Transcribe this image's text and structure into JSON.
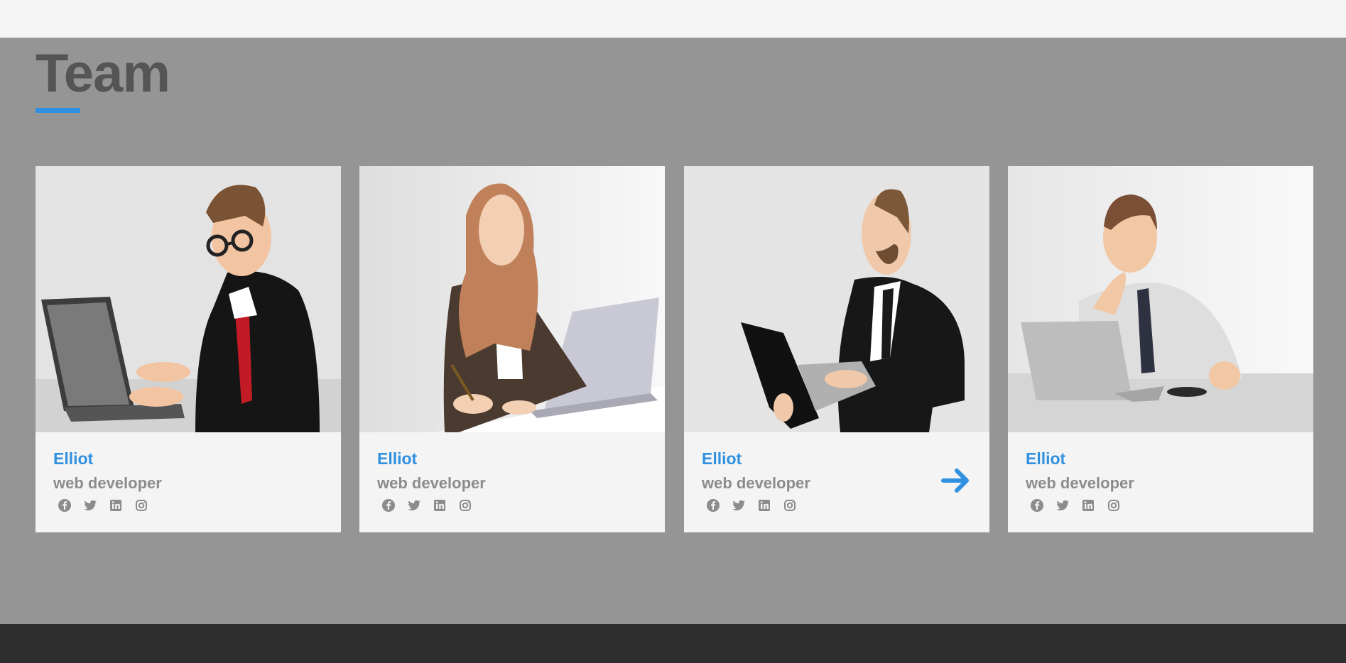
{
  "section": {
    "title": "Team"
  },
  "colors": {
    "accent": "#2f91e0",
    "section_bg": "#959595",
    "footer_bg": "#2e2e2e",
    "card_bg": "#f4f4f4",
    "muted_text": "#8c8c8c"
  },
  "team": [
    {
      "name": "Elliot",
      "role": "web developer",
      "socials": [
        "facebook-icon",
        "twitter-icon",
        "linkedin-icon",
        "instagram-icon"
      ]
    },
    {
      "name": "Elliot",
      "role": "web developer",
      "socials": [
        "facebook-icon",
        "twitter-icon",
        "linkedin-icon",
        "instagram-icon"
      ]
    },
    {
      "name": "Elliot",
      "role": "web developer",
      "socials": [
        "facebook-icon",
        "twitter-icon",
        "linkedin-icon",
        "instagram-icon"
      ],
      "hover_arrow": "arrow-right-icon"
    },
    {
      "name": "Elliot",
      "role": "web developer",
      "socials": [
        "facebook-icon",
        "twitter-icon",
        "linkedin-icon",
        "instagram-icon"
      ]
    }
  ]
}
